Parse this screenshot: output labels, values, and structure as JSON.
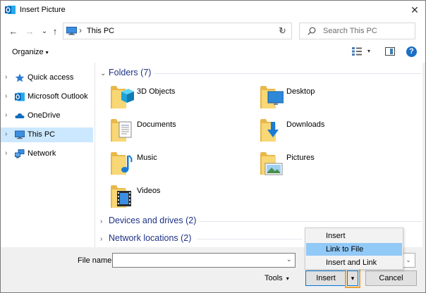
{
  "window": {
    "title": "Insert Picture",
    "close_glyph": "✕"
  },
  "nav": {
    "back_glyph": "←",
    "forward_glyph": "→",
    "recent_glyph": "⌄",
    "up_glyph": "↑",
    "address_sep": "›",
    "address_text": "This PC",
    "address_drop": "⌄",
    "refresh_glyph": "↻",
    "search_placeholder": "Search This PC"
  },
  "toolbar": {
    "organize_label": "Organize",
    "caret": "▾",
    "help_glyph": "?"
  },
  "sidebar": {
    "items": [
      {
        "label": "Quick access",
        "icon": "star-icon"
      },
      {
        "label": "Microsoft Outlook",
        "icon": "outlook-icon"
      },
      {
        "label": "OneDrive",
        "icon": "cloud-icon"
      },
      {
        "label": "This PC",
        "icon": "computer-icon",
        "selected": true
      },
      {
        "label": "Network",
        "icon": "network-icon"
      }
    ],
    "chevron": "›"
  },
  "content": {
    "groups": [
      {
        "label": "Folders (7)",
        "chev": "⌄"
      },
      {
        "label": "Devices and drives (2)",
        "chev": "›"
      },
      {
        "label": "Network locations (2)",
        "chev": "›"
      }
    ],
    "folders": [
      {
        "label": "3D Objects",
        "icon": "3d-objects-folder-icon"
      },
      {
        "label": "Desktop",
        "icon": "desktop-folder-icon"
      },
      {
        "label": "Documents",
        "icon": "documents-folder-icon"
      },
      {
        "label": "Downloads",
        "icon": "downloads-folder-icon"
      },
      {
        "label": "Music",
        "icon": "music-folder-icon"
      },
      {
        "label": "Pictures",
        "icon": "pictures-folder-icon"
      },
      {
        "label": "Videos",
        "icon": "videos-folder-icon"
      }
    ]
  },
  "bottom": {
    "file_name_label": "File name:",
    "file_name_value": "",
    "dropdown_glyph": "⌄",
    "tools_label": "Tools",
    "insert_label": "Insert",
    "split_glyph": "▾",
    "cancel_label": "Cancel"
  },
  "menu": {
    "items": [
      "Insert",
      "Link to File",
      "Insert and Link"
    ],
    "hovered": "Link to File"
  },
  "colors": {
    "accent": "#0078d7",
    "selection": "#cce8ff",
    "menu_hover": "#91c9f7",
    "highlight": "#f5a030",
    "group_heading": "#1e3287",
    "folder_yellow": "#f8d775"
  }
}
